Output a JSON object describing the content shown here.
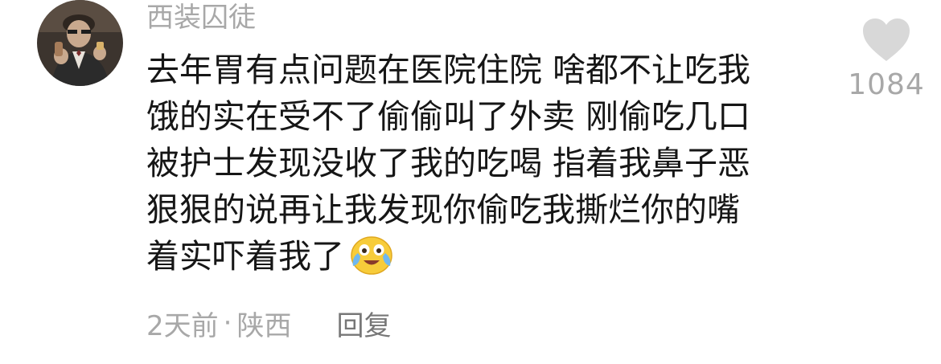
{
  "comment": {
    "username": "西装囚徒",
    "avatar_icon": "user-avatar-photo",
    "lines": [
      "去年胃有点问题在医院住院 啥都不让吃我",
      "饿的实在受不了偷偷叫了外卖 刚偷吃几口",
      "被护士发现没收了我的吃喝 指着我鼻子恶",
      "狠狠的说再让我发现你偷吃我撕烂你的嘴",
      "着实吓着我了"
    ],
    "emoji_icon": "crying-laughing-emoji",
    "like_icon": "heart-icon",
    "like_count": "1084",
    "time": "2天前",
    "separator": "·",
    "location": "陕西",
    "reply_label": "回复"
  },
  "colors": {
    "text_primary": "#161616",
    "text_secondary": "#a8a8a8",
    "heart": "#d8d8d8",
    "reply": "#777777"
  }
}
